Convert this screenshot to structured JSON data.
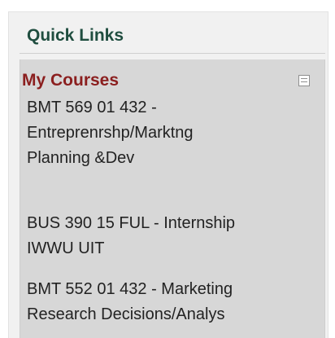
{
  "quick_links": {
    "title": "Quick Links",
    "my_courses": {
      "title": "My Courses",
      "collapse_icon": "collapse-icon",
      "items": [
        {
          "lines": [
            "BMT 569 01 432 -",
            "Entreprenrshp/Marktng",
            "Planning &Dev"
          ]
        },
        {
          "lines": [
            "BUS 390 15 FUL - Internship",
            "IWWU UIT"
          ]
        },
        {
          "lines": [
            "BMT 552 01 432 - Marketing",
            "Research Decisions/Analys"
          ]
        }
      ]
    }
  },
  "colors": {
    "quick_links_title": "#1f4d3f",
    "my_courses_title": "#8b1f1f",
    "panel_background": "#d7d7d7",
    "frame_background": "#f1f1f1",
    "text": "#222222"
  }
}
